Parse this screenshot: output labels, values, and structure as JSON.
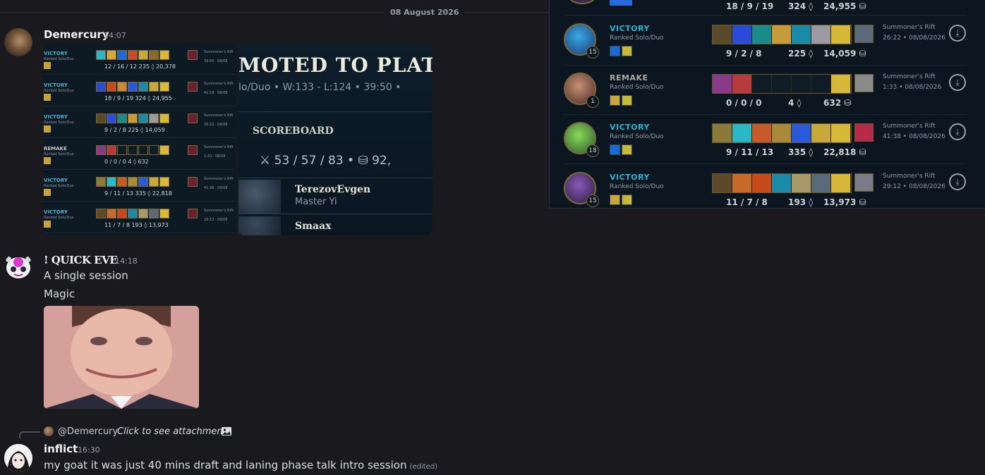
{
  "date_divider": "08 August 2026",
  "messages": [
    {
      "author": "Demercury",
      "time": "14:07"
    },
    {
      "author": "! QUICK EVE",
      "time": "14:18",
      "lines": [
        "A single session",
        "Magic"
      ]
    },
    {
      "author": "inflict",
      "time": "16:30",
      "text": "my goat it was just 40 mins draft and laning phase talk intro session",
      "edited": "(edited)",
      "reply": {
        "mention": "@Demercury",
        "hint": "Click to see attachment"
      }
    }
  ],
  "thumbnail_history": [
    {
      "result": "VICTORY",
      "queue": "Ranked Solo/Duo",
      "stats": "12 / 16 / 12     235 ◊     20,378",
      "mode": "Summoner's Rift",
      "time": "39:50 · 08/08"
    },
    {
      "result": "VICTORY",
      "queue": "Ranked Solo/Duo",
      "stats": "18 / 9 / 19     324 ◊     24,955",
      "mode": "Summoner's Rift",
      "time": "41:19 · 08/08"
    },
    {
      "result": "VICTORY",
      "queue": "Ranked Solo/Duo",
      "stats": "9 / 2 / 8     225 ◊     14,059",
      "mode": "Summoner's Rift",
      "time": "26:22 · 08/08"
    },
    {
      "result": "REMAKE",
      "queue": "Ranked Solo/Duo",
      "stats": "0 / 0 / 0     4 ◊     632",
      "mode": "Summoner's Rift",
      "time": "1:33 · 08/08"
    },
    {
      "result": "VICTORY",
      "queue": "Ranked Solo/Duo",
      "stats": "9 / 11 / 13     335 ◊     22,818",
      "mode": "Summoner's Rift",
      "time": "41:38 · 08/08"
    },
    {
      "result": "VICTORY",
      "queue": "Ranked Solo/Duo",
      "stats": "11 / 7 / 8     193 ◊     13,973",
      "mode": "Summoner's Rift",
      "time": "29:12 · 08/08"
    }
  ],
  "promo": {
    "title": "MOTED TO PLATI",
    "queue_line": "lo/Duo   •   W:133 - L:124   •   39:50   •",
    "scoreboard_label": "SCOREBOARD",
    "score": "⚔ 53 / 57 / 83    •    ⛁ 92,",
    "players": [
      {
        "name": "TerezovEvgen",
        "champion": "Master Yi"
      },
      {
        "name": "Smaax"
      }
    ]
  },
  "match_panel": {
    "top_partial": {
      "kda": "18 / 9 / 19",
      "cs": "324 ◊",
      "gold": "24,955 ⛁"
    },
    "matches": [
      {
        "result": "VICTORY",
        "queue": "Ranked Solo/Duo",
        "level": "15",
        "kda": "9 / 2 / 8",
        "cs": "225 ◊",
        "gold": "14,059 ⛁",
        "mode": "Summoner's Rift",
        "duration": "26:22  •  08/08/2026"
      },
      {
        "result": "REMAKE",
        "queue": "Ranked Solo/Duo",
        "level": "1",
        "kda": "0 / 0 / 0",
        "cs": "4 ◊",
        "gold": "632 ⛁",
        "mode": "Summoner's Rift",
        "duration": "1:33  •  08/08/2026"
      },
      {
        "result": "VICTORY",
        "queue": "Ranked Solo/Duo",
        "level": "18",
        "kda": "9 / 11 / 13",
        "cs": "335 ◊",
        "gold": "22,818 ⛁",
        "mode": "Summoner's Rift",
        "duration": "41:38  •  08/08/2026"
      },
      {
        "result": "VICTORY",
        "queue": "Ranked Solo/Duo",
        "level": "15",
        "kda": "11 / 7 / 8",
        "cs": "193 ◊",
        "gold": "13,973 ⛁",
        "mode": "Summoner's Rift",
        "duration": "29:12  •  08/08/2026"
      }
    ]
  },
  "colors": {
    "background": "#1a1a1e",
    "victory": "#22b7d6",
    "panel": "#0b1620",
    "gold_border": "#7a6a3a"
  }
}
